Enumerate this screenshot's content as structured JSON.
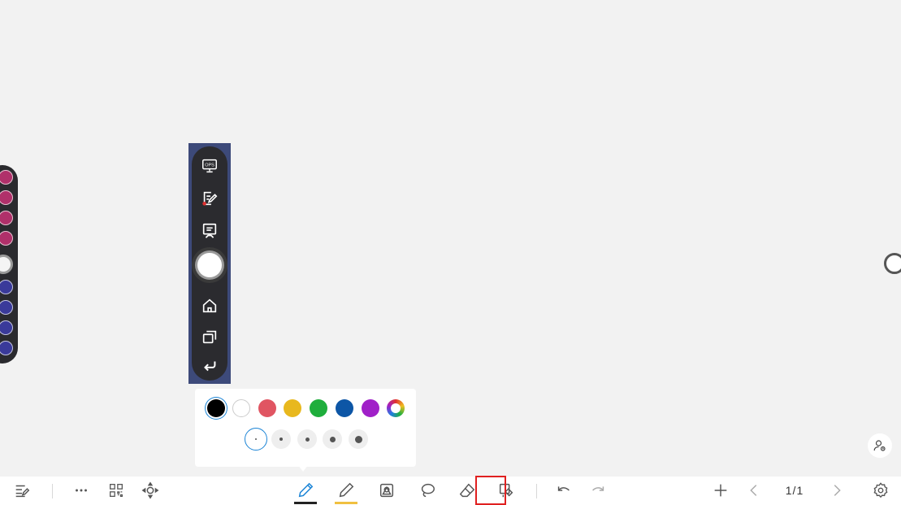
{
  "side_menu": {
    "dot_colors": [
      "#b0306a",
      "#b0306a",
      "#b0306a",
      "#b0306a",
      "#3a3a9a",
      "#3a3a9a",
      "#3a3a9a",
      "#3a3a9a"
    ]
  },
  "quick_menu": {
    "items": [
      {
        "icon": "ops-monitor-icon",
        "label": "OPS"
      },
      {
        "icon": "annotation-icon"
      },
      {
        "icon": "whiteboard-icon"
      },
      {
        "icon": "floating-ball-icon"
      },
      {
        "icon": "home-icon"
      },
      {
        "icon": "multitask-icon"
      },
      {
        "icon": "back-icon"
      }
    ]
  },
  "pen_popup": {
    "colors": [
      "#000000",
      "#ffffff",
      "#e05562",
      "#e8b81e",
      "#1fae3c",
      "#0d56a6",
      "#a020c8",
      "rainbow"
    ],
    "selected_color": "#000000",
    "sizes": [
      "xs",
      "s",
      "m",
      "l",
      "xl"
    ],
    "selected_size": "xs"
  },
  "toolbar": {
    "items": [
      {
        "icon": "menu-list-icon"
      },
      {
        "icon": "more-icon"
      },
      {
        "icon": "qr-code-icon"
      },
      {
        "icon": "move-icon"
      },
      {
        "icon": "pen-icon",
        "active": true
      },
      {
        "icon": "highlighter-icon"
      },
      {
        "icon": "shape-icon"
      },
      {
        "icon": "lasso-icon"
      },
      {
        "icon": "eraser-icon"
      },
      {
        "icon": "eraser-settings-icon"
      },
      {
        "icon": "undo-icon"
      },
      {
        "icon": "redo-icon"
      },
      {
        "icon": "add-page-icon"
      },
      {
        "icon": "prev-page-icon"
      },
      {
        "icon": "next-page-icon"
      },
      {
        "icon": "settings-icon"
      }
    ],
    "page_indicator": "1/1"
  },
  "colors": {
    "accent": "#1b84d6",
    "highlighter": "#f0c040",
    "highlight_box": "#e02020"
  }
}
